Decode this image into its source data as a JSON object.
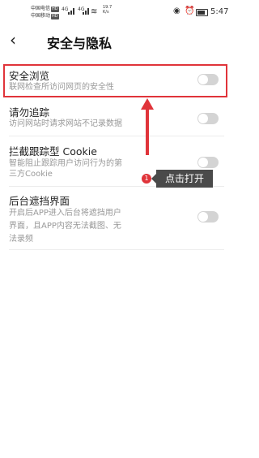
{
  "status_bar": {
    "carrier1": "中国电信",
    "carrier2": "中国移动",
    "hd": "HD",
    "net1": "4G",
    "net2": "4G",
    "speed_value": "19.7",
    "speed_unit": "K/s",
    "time": "5:47"
  },
  "header": {
    "back_icon": "chevron-left-icon",
    "title": "安全与隐私"
  },
  "settings": [
    {
      "title": "安全浏览",
      "subtitle": [
        "联网检查所访问网页的安全性"
      ],
      "enabled": false
    },
    {
      "title": "请勿追踪",
      "subtitle": [
        "访问网站时请求网站不记录数据"
      ],
      "enabled": false
    },
    {
      "title": "拦截跟踪型 Cookie",
      "subtitle": [
        "智能阻止跟踪用户访问行为的第",
        "三方Cookie"
      ],
      "enabled": false
    },
    {
      "title": "后台遮挡界面",
      "subtitle": [
        "开启后APP进入后台将遮挡用户",
        "界面，且APP内容无法截图、无",
        "法录频"
      ],
      "enabled": false
    }
  ],
  "annotation": {
    "badge": "1",
    "tip": "点击打开",
    "accent_color": "#e0343a"
  }
}
